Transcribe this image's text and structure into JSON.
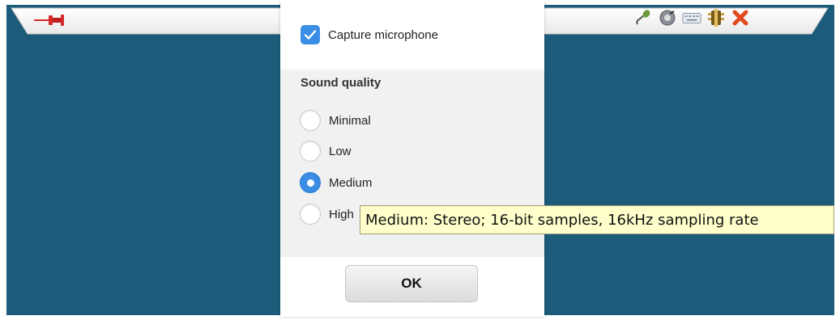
{
  "capture": {
    "label": "Capture microphone",
    "checked": true
  },
  "quality": {
    "title": "Sound quality",
    "options": [
      {
        "label": "Minimal"
      },
      {
        "label": "Low"
      },
      {
        "label": "Medium"
      },
      {
        "label": "High"
      }
    ],
    "selected": "Medium"
  },
  "ok_label": "OK",
  "tooltip": "Medium:  Stereo; 16-bit samples, 16kHz sampling rate",
  "toolbar": {
    "icons": [
      "microphone-icon",
      "sound-icon",
      "keyboard-icon",
      "network-icon",
      "close-icon"
    ]
  },
  "colors": {
    "desktop": "#1c5b7a",
    "accent": "#3a8ee6",
    "tooltip_bg": "#ffffcc",
    "pin": "#d42a2a",
    "close": "#e24a1e"
  }
}
